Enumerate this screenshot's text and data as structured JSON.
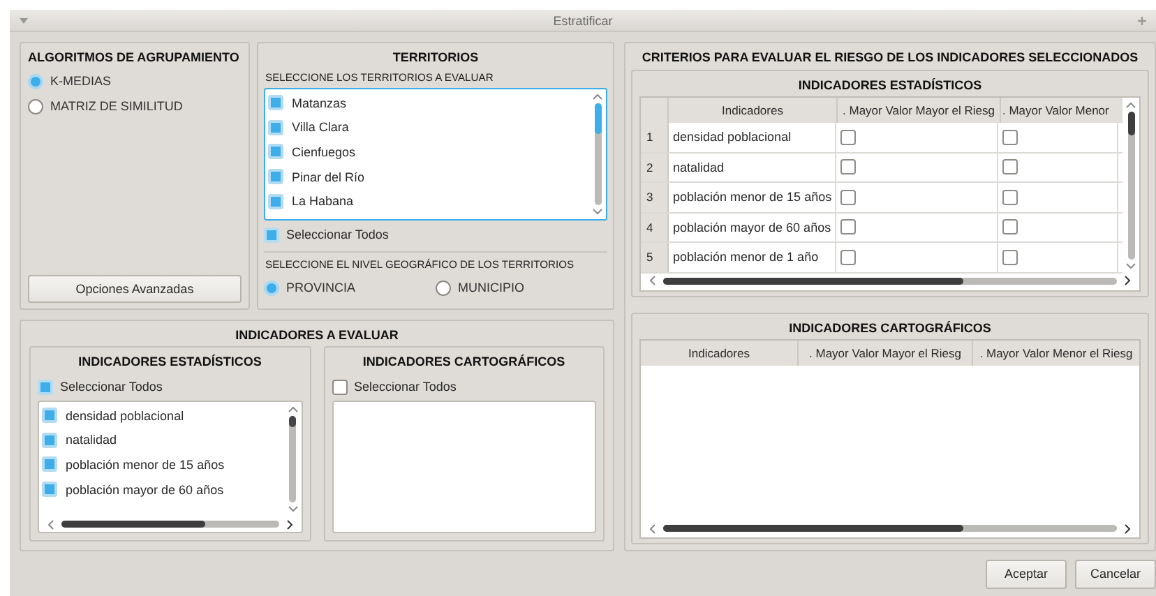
{
  "window": {
    "title": "Estratificar"
  },
  "algorithms": {
    "title": "ALGORITMOS DE AGRUPAMIENTO",
    "options": [
      {
        "label": "K-MEDIAS",
        "selected": true
      },
      {
        "label": "MATRIZ DE SIMILITUD",
        "selected": false
      }
    ],
    "button": "Opciones Avanzadas"
  },
  "territories": {
    "title": "TERRITORIOS",
    "prompt": "SELECCIONE LOS TERRITORIOS A EVALUAR",
    "items": [
      {
        "label": "Matanzas",
        "checked": true
      },
      {
        "label": "Villa Clara",
        "checked": true
      },
      {
        "label": "Cienfuegos",
        "checked": true
      },
      {
        "label": "Pinar del Río",
        "checked": true
      },
      {
        "label": "La Habana",
        "checked": true
      }
    ],
    "select_all": {
      "label": "Seleccionar Todos",
      "checked": true
    },
    "level_prompt": "SELECCIONE EL NIVEL GEOGRÁFICO DE LOS TERRITORIOS",
    "levels": [
      {
        "label": "PROVINCIA",
        "selected": true
      },
      {
        "label": "MUNICIPIO",
        "selected": false
      }
    ]
  },
  "indicators": {
    "title": "INDICADORES A EVALUAR",
    "statistical": {
      "title": "INDICADORES ESTADÍSTICOS",
      "select_all": {
        "label": "Seleccionar Todos",
        "checked": true
      },
      "items": [
        {
          "label": "densidad poblacional",
          "checked": true
        },
        {
          "label": "natalidad",
          "checked": true
        },
        {
          "label": "población menor de 15 años",
          "checked": true
        },
        {
          "label": "población mayor de 60 años",
          "checked": true
        }
      ]
    },
    "cartographic": {
      "title": "INDICADORES CARTOGRÁFICOS",
      "select_all": {
        "label": "Seleccionar Todos",
        "checked": false
      }
    }
  },
  "criteria": {
    "title": "CRITERIOS PARA EVALUAR EL RIESGO DE LOS INDICADORES SELECCIONADOS",
    "statistical": {
      "title": "INDICADORES ESTADÍSTICOS",
      "columns": [
        "Indicadores",
        ". Mayor Valor Mayor el Riesg",
        ". Mayor Valor Menor"
      ],
      "rows": [
        {
          "index": "1",
          "name": "densidad poblacional",
          "higher_more_risk": false,
          "higher_less_risk": false
        },
        {
          "index": "2",
          "name": "natalidad",
          "higher_more_risk": false,
          "higher_less_risk": false
        },
        {
          "index": "3",
          "name": "población menor de 15 años",
          "higher_more_risk": false,
          "higher_less_risk": false
        },
        {
          "index": "4",
          "name": "población mayor de 60 años",
          "higher_more_risk": false,
          "higher_less_risk": false
        },
        {
          "index": "5",
          "name": "población menor de 1 año",
          "higher_more_risk": false,
          "higher_less_risk": false
        }
      ]
    },
    "cartographic": {
      "title": "INDICADORES CARTOGRÁFICOS",
      "columns": [
        "Indicadores",
        ". Mayor Valor Mayor el Riesg",
        ". Mayor Valor Menor el Riesg"
      ]
    }
  },
  "buttons": [
    "Aceptar",
    "Cancelar"
  ]
}
